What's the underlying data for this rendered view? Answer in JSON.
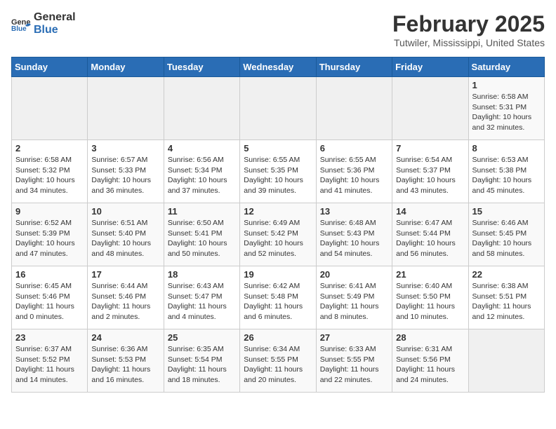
{
  "header": {
    "logo_line1": "General",
    "logo_line2": "Blue",
    "month": "February 2025",
    "location": "Tutwiler, Mississippi, United States"
  },
  "weekdays": [
    "Sunday",
    "Monday",
    "Tuesday",
    "Wednesday",
    "Thursday",
    "Friday",
    "Saturday"
  ],
  "weeks": [
    [
      {
        "day": "",
        "info": ""
      },
      {
        "day": "",
        "info": ""
      },
      {
        "day": "",
        "info": ""
      },
      {
        "day": "",
        "info": ""
      },
      {
        "day": "",
        "info": ""
      },
      {
        "day": "",
        "info": ""
      },
      {
        "day": "1",
        "info": "Sunrise: 6:58 AM\nSunset: 5:31 PM\nDaylight: 10 hours\nand 32 minutes."
      }
    ],
    [
      {
        "day": "2",
        "info": "Sunrise: 6:58 AM\nSunset: 5:32 PM\nDaylight: 10 hours\nand 34 minutes."
      },
      {
        "day": "3",
        "info": "Sunrise: 6:57 AM\nSunset: 5:33 PM\nDaylight: 10 hours\nand 36 minutes."
      },
      {
        "day": "4",
        "info": "Sunrise: 6:56 AM\nSunset: 5:34 PM\nDaylight: 10 hours\nand 37 minutes."
      },
      {
        "day": "5",
        "info": "Sunrise: 6:55 AM\nSunset: 5:35 PM\nDaylight: 10 hours\nand 39 minutes."
      },
      {
        "day": "6",
        "info": "Sunrise: 6:55 AM\nSunset: 5:36 PM\nDaylight: 10 hours\nand 41 minutes."
      },
      {
        "day": "7",
        "info": "Sunrise: 6:54 AM\nSunset: 5:37 PM\nDaylight: 10 hours\nand 43 minutes."
      },
      {
        "day": "8",
        "info": "Sunrise: 6:53 AM\nSunset: 5:38 PM\nDaylight: 10 hours\nand 45 minutes."
      }
    ],
    [
      {
        "day": "9",
        "info": "Sunrise: 6:52 AM\nSunset: 5:39 PM\nDaylight: 10 hours\nand 47 minutes."
      },
      {
        "day": "10",
        "info": "Sunrise: 6:51 AM\nSunset: 5:40 PM\nDaylight: 10 hours\nand 48 minutes."
      },
      {
        "day": "11",
        "info": "Sunrise: 6:50 AM\nSunset: 5:41 PM\nDaylight: 10 hours\nand 50 minutes."
      },
      {
        "day": "12",
        "info": "Sunrise: 6:49 AM\nSunset: 5:42 PM\nDaylight: 10 hours\nand 52 minutes."
      },
      {
        "day": "13",
        "info": "Sunrise: 6:48 AM\nSunset: 5:43 PM\nDaylight: 10 hours\nand 54 minutes."
      },
      {
        "day": "14",
        "info": "Sunrise: 6:47 AM\nSunset: 5:44 PM\nDaylight: 10 hours\nand 56 minutes."
      },
      {
        "day": "15",
        "info": "Sunrise: 6:46 AM\nSunset: 5:45 PM\nDaylight: 10 hours\nand 58 minutes."
      }
    ],
    [
      {
        "day": "16",
        "info": "Sunrise: 6:45 AM\nSunset: 5:46 PM\nDaylight: 11 hours\nand 0 minutes."
      },
      {
        "day": "17",
        "info": "Sunrise: 6:44 AM\nSunset: 5:46 PM\nDaylight: 11 hours\nand 2 minutes."
      },
      {
        "day": "18",
        "info": "Sunrise: 6:43 AM\nSunset: 5:47 PM\nDaylight: 11 hours\nand 4 minutes."
      },
      {
        "day": "19",
        "info": "Sunrise: 6:42 AM\nSunset: 5:48 PM\nDaylight: 11 hours\nand 6 minutes."
      },
      {
        "day": "20",
        "info": "Sunrise: 6:41 AM\nSunset: 5:49 PM\nDaylight: 11 hours\nand 8 minutes."
      },
      {
        "day": "21",
        "info": "Sunrise: 6:40 AM\nSunset: 5:50 PM\nDaylight: 11 hours\nand 10 minutes."
      },
      {
        "day": "22",
        "info": "Sunrise: 6:38 AM\nSunset: 5:51 PM\nDaylight: 11 hours\nand 12 minutes."
      }
    ],
    [
      {
        "day": "23",
        "info": "Sunrise: 6:37 AM\nSunset: 5:52 PM\nDaylight: 11 hours\nand 14 minutes."
      },
      {
        "day": "24",
        "info": "Sunrise: 6:36 AM\nSunset: 5:53 PM\nDaylight: 11 hours\nand 16 minutes."
      },
      {
        "day": "25",
        "info": "Sunrise: 6:35 AM\nSunset: 5:54 PM\nDaylight: 11 hours\nand 18 minutes."
      },
      {
        "day": "26",
        "info": "Sunrise: 6:34 AM\nSunset: 5:55 PM\nDaylight: 11 hours\nand 20 minutes."
      },
      {
        "day": "27",
        "info": "Sunrise: 6:33 AM\nSunset: 5:55 PM\nDaylight: 11 hours\nand 22 minutes."
      },
      {
        "day": "28",
        "info": "Sunrise: 6:31 AM\nSunset: 5:56 PM\nDaylight: 11 hours\nand 24 minutes."
      },
      {
        "day": "",
        "info": ""
      }
    ]
  ]
}
